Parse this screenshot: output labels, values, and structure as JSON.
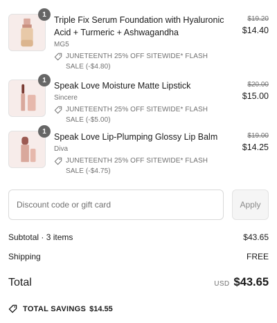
{
  "line_items": [
    {
      "quantity": "1",
      "title": "Triple Fix Serum Foundation with Hyaluronic Acid + Turmeric + Ashwagandha",
      "variant": "MG5",
      "discount": "JUNETEENTH 25% OFF SITEWIDE* FLASH SALE (-$4.80)",
      "original_price": "$19.20",
      "price": "$14.40"
    },
    {
      "quantity": "1",
      "title": "Speak Love Moisture Matte Lipstick",
      "variant": "Sincere",
      "discount": "JUNETEENTH 25% OFF SITEWIDE* FLASH SALE (-$5.00)",
      "original_price": "$20.00",
      "price": "$15.00"
    },
    {
      "quantity": "1",
      "title": "Speak Love Lip-Plumping Glossy Lip Balm",
      "variant": "Diva",
      "discount": "JUNETEENTH 25% OFF SITEWIDE* FLASH SALE (-$4.75)",
      "original_price": "$19.00",
      "price": "$14.25"
    }
  ],
  "discount_code": {
    "placeholder": "Discount code or gift card",
    "value": "",
    "apply_label": "Apply"
  },
  "summary": {
    "subtotal_label": "Subtotal · 3 items",
    "subtotal_value": "$43.65",
    "shipping_label": "Shipping",
    "shipping_value": "FREE",
    "total_label": "Total",
    "currency": "USD",
    "total_value": "$43.65"
  },
  "savings": {
    "label": "TOTAL SAVINGS",
    "value": "$14.55"
  },
  "icons": {
    "discount_tag": "tag-icon",
    "savings_tag": "tag-icon"
  },
  "colors": {
    "badge": "#666666",
    "muted_text": "#707070",
    "border": "#d9d9d9",
    "thumb_bg": "#f7ecea",
    "rose_gold": "#d9a89c"
  }
}
